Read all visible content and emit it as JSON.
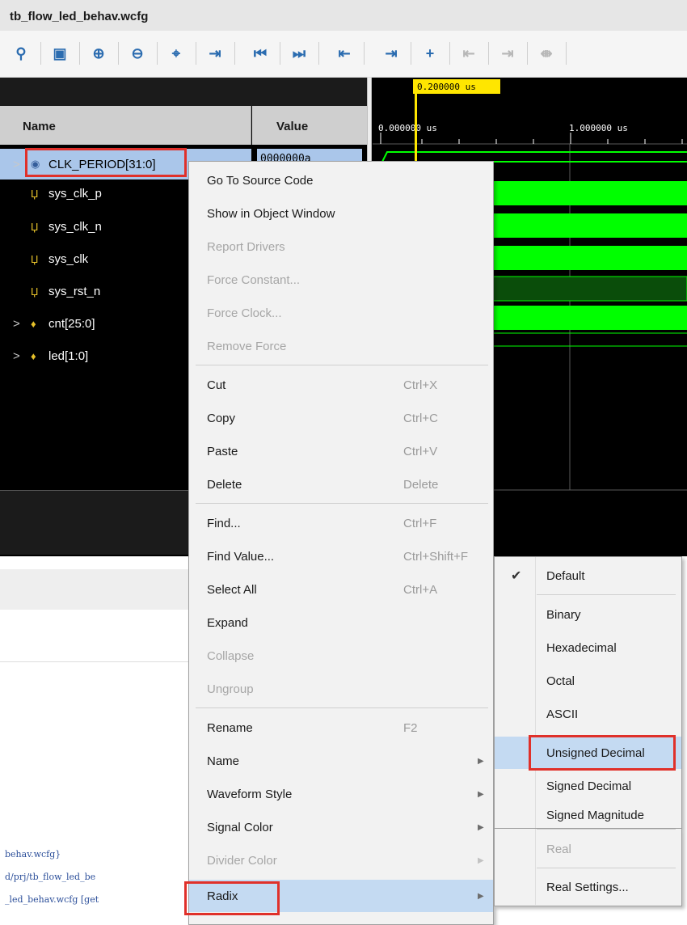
{
  "window": {
    "title": "tb_flow_led_behav.wcfg"
  },
  "toolbar": {
    "icons": [
      "search-icon",
      "save-icon",
      "zoom-in-icon",
      "zoom-out-icon",
      "zoom-fit-icon",
      "go-to-cursor-icon",
      "go-to-time-0-icon",
      "go-to-last-time-icon",
      "previous-transition-icon",
      "next-transition-icon",
      "add-marker-icon",
      "previous-marker-icon",
      "next-marker-icon",
      "swap-cursors-icon"
    ]
  },
  "waveform": {
    "cursor_time": "0.200000 us",
    "columns": {
      "name": "Name",
      "value": "Value"
    },
    "time_ruler": {
      "start": "0.000000 us",
      "mid": "1.000000 us"
    },
    "signals": [
      {
        "name": "CLK_PERIOD[31:0]",
        "value": "0000000a",
        "expandable": true,
        "selected": true,
        "icon": "parameter-icon"
      },
      {
        "name": "sys_clk_p",
        "value": "",
        "expandable": false,
        "selected": false,
        "icon": "wire-icon"
      },
      {
        "name": "sys_clk_n",
        "value": "",
        "expandable": false,
        "selected": false,
        "icon": "wire-icon"
      },
      {
        "name": "sys_clk",
        "value": "",
        "expandable": false,
        "selected": false,
        "icon": "wire-icon"
      },
      {
        "name": "sys_rst_n",
        "value": "",
        "expandable": false,
        "selected": false,
        "icon": "wire-icon"
      },
      {
        "name": "cnt[25:0]",
        "value": "",
        "expandable": true,
        "selected": false,
        "icon": "bus-icon"
      },
      {
        "name": "led[1:0]",
        "value": "",
        "expandable": true,
        "selected": false,
        "icon": "bus-icon"
      }
    ],
    "colors": {
      "wave": "#00ff00",
      "wave_dim": "#0a4d0a",
      "cursor": "#ffe600",
      "highlight": "#e0302a"
    }
  },
  "context_menu": {
    "items": [
      {
        "label": "Go To Source Code",
        "shortcut": "",
        "disabled": false,
        "submenu": false
      },
      {
        "label": "Show in Object Window",
        "shortcut": "",
        "disabled": false,
        "submenu": false
      },
      {
        "label": "Report Drivers",
        "shortcut": "",
        "disabled": true,
        "submenu": false
      },
      {
        "label": "Force Constant...",
        "shortcut": "",
        "disabled": true,
        "submenu": false
      },
      {
        "label": "Force Clock...",
        "shortcut": "",
        "disabled": true,
        "submenu": false
      },
      {
        "label": "Remove Force",
        "shortcut": "",
        "disabled": true,
        "submenu": false
      },
      {
        "label": "Cut",
        "shortcut": "Ctrl+X",
        "disabled": false,
        "submenu": false
      },
      {
        "label": "Copy",
        "shortcut": "Ctrl+C",
        "disabled": false,
        "submenu": false
      },
      {
        "label": "Paste",
        "shortcut": "Ctrl+V",
        "disabled": false,
        "submenu": false
      },
      {
        "label": "Delete",
        "shortcut": "Delete",
        "disabled": false,
        "submenu": false
      },
      {
        "label": "Find...",
        "shortcut": "Ctrl+F",
        "disabled": false,
        "submenu": false
      },
      {
        "label": "Find Value...",
        "shortcut": "Ctrl+Shift+F",
        "disabled": false,
        "submenu": false
      },
      {
        "label": "Select All",
        "shortcut": "Ctrl+A",
        "disabled": false,
        "submenu": false
      },
      {
        "label": "Expand",
        "shortcut": "",
        "disabled": false,
        "submenu": false
      },
      {
        "label": "Collapse",
        "shortcut": "",
        "disabled": true,
        "submenu": false
      },
      {
        "label": "Ungroup",
        "shortcut": "",
        "disabled": true,
        "submenu": false
      },
      {
        "label": "Rename",
        "shortcut": "F2",
        "disabled": false,
        "submenu": false
      },
      {
        "label": "Name",
        "shortcut": "",
        "disabled": false,
        "submenu": true
      },
      {
        "label": "Waveform Style",
        "shortcut": "",
        "disabled": false,
        "submenu": true
      },
      {
        "label": "Signal Color",
        "shortcut": "",
        "disabled": false,
        "submenu": true
      },
      {
        "label": "Divider Color",
        "shortcut": "",
        "disabled": true,
        "submenu": true
      },
      {
        "label": "Radix",
        "shortcut": "",
        "disabled": false,
        "submenu": true,
        "highlighted": true
      }
    ]
  },
  "radix_menu": {
    "items": [
      {
        "label": "Default",
        "checked": true,
        "disabled": false
      },
      {
        "label": "Binary",
        "checked": false,
        "disabled": false
      },
      {
        "label": "Hexadecimal",
        "checked": false,
        "disabled": false
      },
      {
        "label": "Octal",
        "checked": false,
        "disabled": false
      },
      {
        "label": "ASCII",
        "checked": false,
        "disabled": false
      },
      {
        "label": "Unsigned Decimal",
        "checked": false,
        "disabled": false,
        "highlighted": true
      },
      {
        "label": "Signed Decimal",
        "checked": false,
        "disabled": false
      },
      {
        "label": "Signed Magnitude",
        "checked": false,
        "disabled": false
      },
      {
        "label": "Real",
        "checked": false,
        "disabled": true
      },
      {
        "label": "Real Settings...",
        "checked": false,
        "disabled": false
      }
    ]
  },
  "console": {
    "lines": [
      "behav.wcfg}",
      "d/prj/tb_flow_led_be",
      "_led_behav.wcfg [get"
    ]
  }
}
